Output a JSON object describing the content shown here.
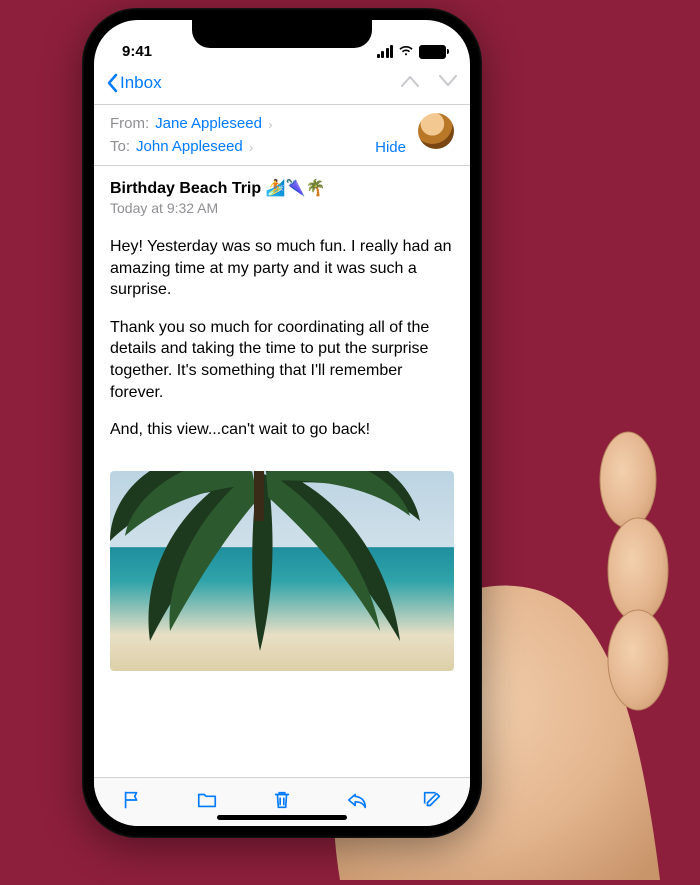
{
  "status": {
    "time": "9:41"
  },
  "nav": {
    "back_label": "Inbox"
  },
  "header": {
    "from_lbl": "From:",
    "from_name": "Jane Appleseed",
    "to_lbl": "To:",
    "to_name": "John Appleseed",
    "hide": "Hide"
  },
  "message": {
    "subject": "Birthday Beach Trip 🏄🌂🌴",
    "timestamp": "Today at 9:32 AM",
    "p1": "Hey! Yesterday was so much fun. I really had an amazing time at my party and it was such a surprise.",
    "p2": "Thank you so much for coordinating all of the details and taking the time to put the surprise together. It's something that I'll remember forever.",
    "p3": "And, this view...can't wait to go back!"
  },
  "toolbar": {
    "flag": "flag",
    "folder": "folder",
    "trash": "trash",
    "reply": "reply",
    "compose": "compose"
  }
}
